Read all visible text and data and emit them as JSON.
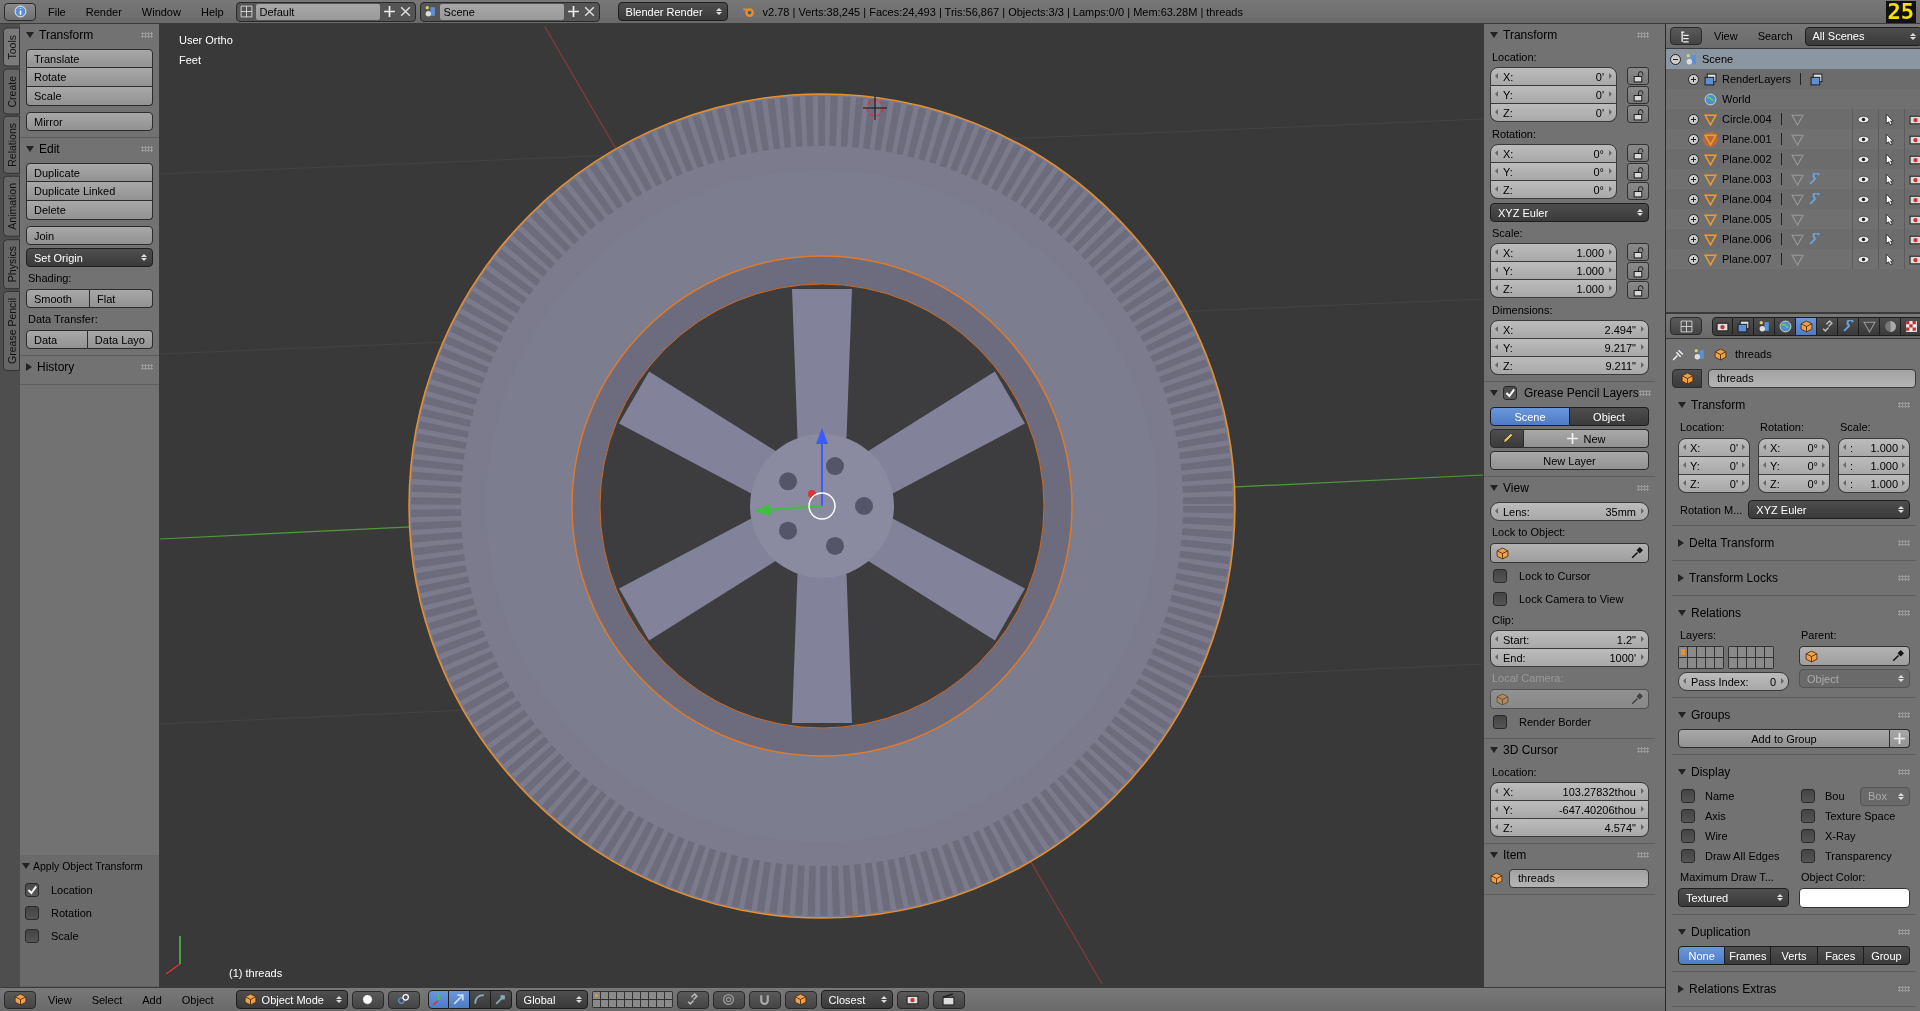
{
  "header": {
    "menu": [
      "File",
      "Render",
      "Window",
      "Help"
    ],
    "layout": "Default",
    "scene": "Scene",
    "engine": "Blender Render",
    "stats": "v2.78 | Verts:38,245 | Faces:24,493 | Tris:56,867 | Objects:3/3 | Lamps:0/0 | Mem:63.28M | threads",
    "badge": "25"
  },
  "tool_tabs": [
    {
      "label": "Tools",
      "selected": true
    },
    {
      "label": "Create",
      "selected": false
    },
    {
      "label": "Relations",
      "selected": false
    },
    {
      "label": "Animation",
      "selected": false
    },
    {
      "label": "Physics",
      "selected": false
    },
    {
      "label": "Grease Pencil",
      "selected": false
    }
  ],
  "tool_shelf": {
    "panels": [
      {
        "title": "Transform",
        "expanded": true,
        "items": [
          {
            "kind": "stack",
            "labels": [
              "Translate",
              "Rotate",
              "Scale"
            ]
          },
          {
            "kind": "stack",
            "labels": [
              "Mirror"
            ]
          }
        ]
      },
      {
        "title": "Edit",
        "expanded": true,
        "items": [
          {
            "kind": "stack",
            "labels": [
              "Duplicate",
              "Duplicate Linked",
              "Delete"
            ]
          },
          {
            "kind": "stack",
            "labels": [
              "Join"
            ]
          },
          {
            "kind": "dropdown",
            "label": "Set Origin"
          },
          {
            "kind": "label",
            "label": "Shading:"
          },
          {
            "kind": "row",
            "labels": [
              "Smooth",
              "Flat"
            ]
          },
          {
            "kind": "label",
            "label": "Data Transfer:"
          },
          {
            "kind": "row",
            "labels": [
              "Data",
              "Data Layo"
            ]
          }
        ]
      },
      {
        "title": "History",
        "expanded": false
      }
    ],
    "operator": {
      "title": "Apply Object Transform",
      "options": [
        {
          "label": "Location",
          "checked": true
        },
        {
          "label": "Rotation",
          "checked": false
        },
        {
          "label": "Scale",
          "checked": false
        }
      ]
    }
  },
  "viewport": {
    "view_name": "User Ortho",
    "units": "Feet",
    "object_label": "(1) threads"
  },
  "n_panel": {
    "panels": [
      {
        "title": "Transform",
        "expanded": true,
        "items": [
          {
            "kind": "vector",
            "label": "Location:",
            "locks": true,
            "fields": [
              {
                "axis": "X:",
                "value": "0'"
              },
              {
                "axis": "Y:",
                "value": "0'"
              },
              {
                "axis": "Z:",
                "value": "0'"
              }
            ]
          },
          {
            "kind": "vector",
            "label": "Rotation:",
            "locks": true,
            "fields": [
              {
                "axis": "X:",
                "value": "0°"
              },
              {
                "axis": "Y:",
                "value": "0°"
              },
              {
                "axis": "Z:",
                "value": "0°"
              }
            ]
          },
          {
            "kind": "dropdown",
            "label": "XYZ Euler"
          },
          {
            "kind": "vector",
            "label": "Scale:",
            "locks": true,
            "fields": [
              {
                "axis": "X:",
                "value": "1.000"
              },
              {
                "axis": "Y:",
                "value": "1.000"
              },
              {
                "axis": "Z:",
                "value": "1.000"
              }
            ]
          },
          {
            "kind": "vector",
            "label": "Dimensions:",
            "locks": false,
            "fields": [
              {
                "axis": "X:",
                "value": "2.494\""
              },
              {
                "axis": "Y:",
                "value": "9.217\""
              },
              {
                "axis": "Z:",
                "value": "9.211\""
              }
            ]
          }
        ]
      },
      {
        "title": "Grease Pencil Layers",
        "expanded": true,
        "checked": true,
        "items": [
          {
            "kind": "segmented",
            "options": [
              {
                "label": "Scene",
                "selected": true
              },
              {
                "label": "Object",
                "selected": false
              }
            ]
          },
          {
            "kind": "pencil_new",
            "label": "New"
          },
          {
            "kind": "button",
            "label": "New Layer"
          }
        ]
      },
      {
        "title": "View",
        "expanded": true,
        "items": [
          {
            "kind": "field",
            "label": "Lens:",
            "value": "35mm"
          },
          {
            "kind": "label",
            "label": "Lock to Object:",
            "disabled": false
          },
          {
            "kind": "picker",
            "disabled": false
          },
          {
            "kind": "checkbox",
            "label": "Lock to Cursor",
            "checked": false
          },
          {
            "kind": "checkbox",
            "label": "Lock Camera to View",
            "checked": false
          },
          {
            "kind": "vector",
            "label": "Clip:",
            "locks": false,
            "fields": [
              {
                "axis": "Start:",
                "value": "1.2\""
              },
              {
                "axis": "End:",
                "value": "1000'"
              }
            ]
          },
          {
            "kind": "label",
            "label": "Local Camera:",
            "disabled": true
          },
          {
            "kind": "picker",
            "disabled": true
          },
          {
            "kind": "checkbox",
            "label": "Render Border",
            "checked": false
          }
        ]
      },
      {
        "title": "3D Cursor",
        "expanded": true,
        "items": [
          {
            "kind": "vector",
            "label": "Location:",
            "locks": false,
            "fields": [
              {
                "axis": "X:",
                "value": "103.27832thou"
              },
              {
                "axis": "Y:",
                "value": "-647.40206thou"
              },
              {
                "axis": "Z:",
                "value": "4.574\""
              }
            ]
          }
        ]
      },
      {
        "title": "Item",
        "expanded": true,
        "items": [
          {
            "kind": "name",
            "value": "threads"
          }
        ]
      }
    ]
  },
  "outliner": {
    "menu": [
      "View",
      "Search"
    ],
    "display_mode": "All Scenes",
    "tree": [
      {
        "kind": "scene",
        "label": "Scene",
        "expanded": true,
        "selected": true,
        "children": [
          {
            "kind": "renderlayers",
            "label": "RenderLayers",
            "expanded": false,
            "selected": false
          },
          {
            "kind": "world",
            "label": "World",
            "selected": false
          },
          {
            "kind": "object",
            "label": "Circle.004",
            "expanded": false,
            "selected": false,
            "active": false,
            "modifiers": false
          },
          {
            "kind": "object",
            "label": "Plane.001",
            "expanded": false,
            "selected": false,
            "active": true,
            "modifiers": false
          },
          {
            "kind": "object",
            "label": "Plane.002",
            "expanded": false,
            "selected": false,
            "active": false,
            "modifiers": false
          },
          {
            "kind": "object",
            "label": "Plane.003",
            "expanded": false,
            "selected": false,
            "active": false,
            "modifiers": true
          },
          {
            "kind": "object",
            "label": "Plane.004",
            "expanded": false,
            "selected": false,
            "active": false,
            "modifiers": true
          },
          {
            "kind": "object",
            "label": "Plane.005",
            "expanded": false,
            "selected": false,
            "active": false,
            "modifiers": false
          },
          {
            "kind": "object",
            "label": "Plane.006",
            "expanded": false,
            "selected": false,
            "active": false,
            "modifiers": true
          },
          {
            "kind": "object",
            "label": "Plane.007",
            "expanded": false,
            "selected": false,
            "active": false,
            "modifiers": false
          }
        ]
      }
    ]
  },
  "properties": {
    "tabs": [
      {
        "kind": "render",
        "selected": false
      },
      {
        "kind": "layers",
        "selected": false
      },
      {
        "kind": "scene",
        "selected": false
      },
      {
        "kind": "world",
        "selected": false
      },
      {
        "kind": "object",
        "selected": true
      },
      {
        "kind": "constraints",
        "selected": false
      },
      {
        "kind": "modifiers",
        "selected": false
      },
      {
        "kind": "data",
        "selected": false
      },
      {
        "kind": "material",
        "selected": false
      },
      {
        "kind": "texture",
        "selected": false
      }
    ],
    "breadcrumb": "threads",
    "name": "threads",
    "panels": [
      {
        "kind": "transform",
        "title": "Transform",
        "expanded": true,
        "columns": [
          {
            "label": "Location:",
            "fields": [
              {
                "axis": "X:",
                "value": "0'"
              },
              {
                "axis": "Y:",
                "value": "0'"
              },
              {
                "axis": "Z:",
                "value": "0'"
              }
            ]
          },
          {
            "label": "Rotation:",
            "fields": [
              {
                "axis": "X:",
                "value": "0°"
              },
              {
                "axis": "Y:",
                "value": "0°"
              },
              {
                "axis": "Z:",
                "value": "0°"
              }
            ]
          },
          {
            "label": "Scale:",
            "fields": [
              {
                "axis": ":",
                "value": "1.000"
              },
              {
                "axis": ":",
                "value": "1.000"
              },
              {
                "axis": ":",
                "value": "1.000"
              }
            ]
          }
        ],
        "mode_label": "Rotation M...",
        "mode": "XYZ Euler"
      },
      {
        "title": "Delta Transform",
        "expanded": false
      },
      {
        "title": "Transform Locks",
        "expanded": false
      },
      {
        "kind": "relations",
        "title": "Relations",
        "expanded": true,
        "layers_label": "Layers:",
        "parent_label": "Parent:",
        "parent_type": "Object",
        "pass_label": "Pass Index:",
        "pass_value": "0",
        "layers": [
          {
            "on": true
          },
          {
            "on": false
          },
          {
            "on": false
          },
          {
            "on": false
          },
          {
            "on": false
          },
          {
            "on": false
          },
          {
            "on": false
          },
          {
            "on": false
          },
          {
            "on": false
          },
          {
            "on": false
          },
          {
            "on": false
          },
          {
            "on": false
          },
          {
            "on": false
          },
          {
            "on": false
          },
          {
            "on": false
          },
          {
            "on": false
          },
          {
            "on": false
          },
          {
            "on": false
          },
          {
            "on": false
          },
          {
            "on": false
          }
        ]
      },
      {
        "kind": "groups",
        "title": "Groups",
        "expanded": true,
        "button": "Add to Group"
      },
      {
        "kind": "display",
        "title": "Display",
        "expanded": true,
        "options": [
          {
            "label": "Name",
            "checked": false
          },
          {
            "label": "Bou",
            "checked": false
          },
          {
            "label": "Axis",
            "checked": false
          },
          {
            "label": "Texture Space",
            "checked": false
          },
          {
            "label": "Wire",
            "checked": false
          },
          {
            "label": "X-Ray",
            "checked": false
          },
          {
            "label": "Draw All Edges",
            "checked": false
          },
          {
            "label": "Transparency",
            "checked": false
          }
        ],
        "bounds_type": "Box",
        "max_label": "Maximum Draw T...",
        "max_value": "Textured",
        "color_label": "Object Color:"
      },
      {
        "kind": "segmented",
        "title": "Duplication",
        "expanded": true,
        "options": [
          {
            "label": "None",
            "selected": true
          },
          {
            "label": "Frames",
            "selected": false
          },
          {
            "label": "Verts",
            "selected": false
          },
          {
            "label": "Faces",
            "selected": false
          },
          {
            "label": "Group",
            "selected": false
          }
        ]
      },
      {
        "title": "Relations Extras",
        "expanded": false
      }
    ]
  },
  "bottom_bar": {
    "menu": [
      "View",
      "Select",
      "Add",
      "Object"
    ],
    "mode": "Object Mode",
    "orientation": "Global",
    "snap_target": "Closest",
    "manipulators": [
      {
        "kind": "axes",
        "selected": true
      },
      {
        "kind": "translate",
        "selected": true
      },
      {
        "kind": "rotate",
        "selected": false
      },
      {
        "kind": "scale",
        "selected": false
      }
    ],
    "layers": [
      {
        "on": true
      },
      {
        "on": false
      },
      {
        "on": false
      },
      {
        "on": false
      },
      {
        "on": false
      },
      {
        "on": false
      },
      {
        "on": false
      },
      {
        "on": false
      },
      {
        "on": false
      },
      {
        "on": false
      },
      {
        "on": false
      },
      {
        "on": false
      },
      {
        "on": false
      },
      {
        "on": false
      },
      {
        "on": false
      },
      {
        "on": false
      },
      {
        "on": false
      },
      {
        "on": false
      },
      {
        "on": false
      },
      {
        "on": false
      }
    ]
  }
}
